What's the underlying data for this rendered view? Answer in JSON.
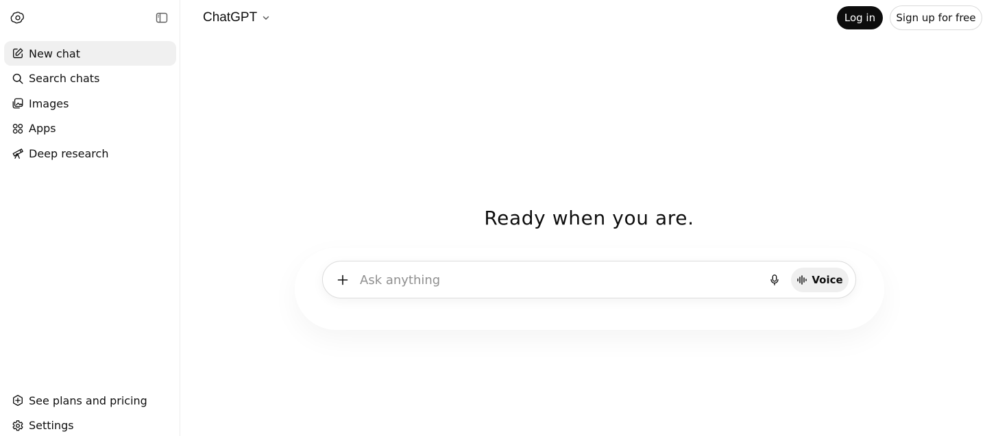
{
  "app": {
    "title": "ChatGPT"
  },
  "sidebar": {
    "items": [
      {
        "label": "New chat",
        "icon": "new-chat-icon"
      },
      {
        "label": "Search chats",
        "icon": "search-icon"
      },
      {
        "label": "Images",
        "icon": "images-icon"
      },
      {
        "label": "Apps",
        "icon": "apps-icon"
      },
      {
        "label": "Deep research",
        "icon": "telescope-icon"
      }
    ],
    "bottom": [
      {
        "label": "See plans and pricing",
        "icon": "plans-icon"
      },
      {
        "label": "Settings",
        "icon": "gear-icon"
      }
    ]
  },
  "header": {
    "model_label": "ChatGPT",
    "login_label": "Log in",
    "signup_label": "Sign up for free"
  },
  "main": {
    "headline": "Ready when you are.",
    "composer": {
      "placeholder": "Ask anything",
      "value": "",
      "voice_label": "Voice"
    }
  },
  "colors": {
    "text": "#0d0d0d",
    "active_item_bg": "#f0f0f0",
    "login_bg": "#0d0d0d",
    "voice_bg": "#efefef",
    "placeholder": "#8f8f8f"
  }
}
